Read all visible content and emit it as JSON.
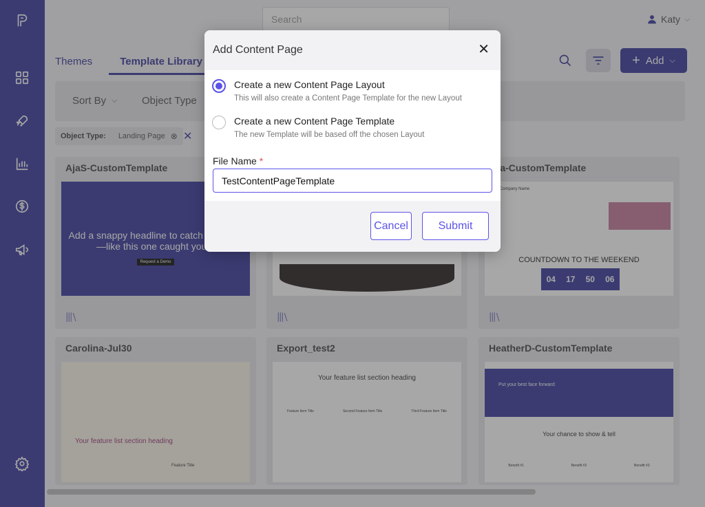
{
  "topbar": {
    "search_placeholder": "Search",
    "user_name": "Katy"
  },
  "tabs": [
    {
      "label": "Themes"
    },
    {
      "label": "Template Library"
    }
  ],
  "toolbar": {
    "add_label": "Add"
  },
  "filters": {
    "sort_by": "Sort By",
    "object_type": "Object Type"
  },
  "active_filter": {
    "label": "Object Type:",
    "value": "Landing Page"
  },
  "cards": [
    {
      "title": "AjaS-CustomTemplate",
      "thumb_text": "Add a snappy headline to catch attention—like this one caught yours",
      "thumb_button": "Request a Demo"
    },
    {
      "title": "",
      "thumb_text": ""
    },
    {
      "title": "hea-CustomTemplate",
      "thumb_text": "COUNTDOWN TO THE WEEKEND",
      "countdown": [
        "04",
        "17",
        "50",
        "06"
      ],
      "company": "Your Company Name"
    },
    {
      "title": "Carolina-Jul30",
      "thumb_text": "Your feature list section heading",
      "thumb_sub": "Feature Title"
    },
    {
      "title": "Export_test2",
      "thumb_text": "Your feature list section heading",
      "features": [
        "Feature Item Title",
        "Second Feature Item Title",
        "Third Feature Item Title"
      ]
    },
    {
      "title": "HeatherD-CustomTemplate",
      "thumb_text": "Your chance to show & tell",
      "hero": "Put your best face forward",
      "benefits": [
        "Benefit #1",
        "Benefit #2",
        "Benefit #3"
      ]
    }
  ],
  "modal": {
    "title": "Add Content Page",
    "options": [
      {
        "label": "Create a new Content Page Layout",
        "desc": "This will also create a Content Page Template for the new Layout",
        "selected": true
      },
      {
        "label": "Create a new Content Page Template",
        "desc": "The new Template will be based off the chosen Layout",
        "selected": false
      }
    ],
    "file_name_label": "File Name",
    "required_mark": "*",
    "file_name_value": "TestContentPageTemplate",
    "cancel_label": "Cancel",
    "submit_label": "Submit"
  }
}
